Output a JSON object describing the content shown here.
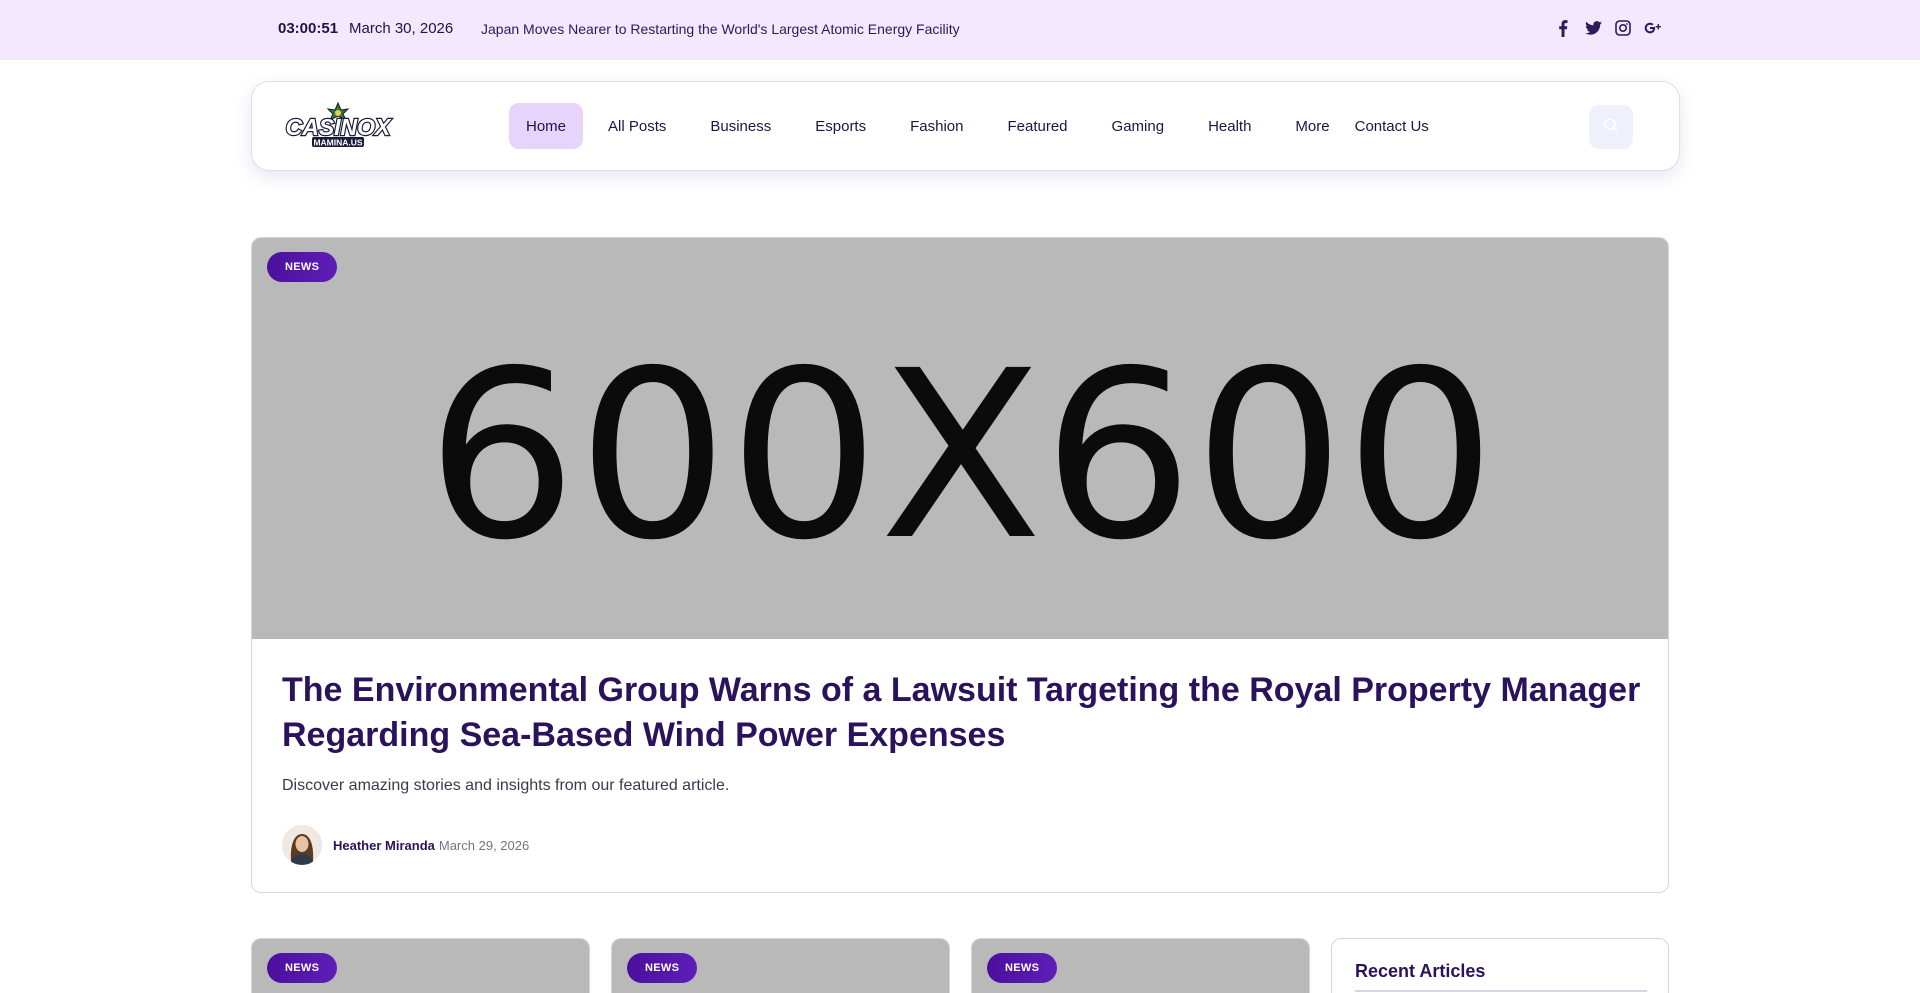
{
  "topbar": {
    "time": "03:00:51",
    "date": "March 30, 2026",
    "ticker": "Japan Moves Nearer to Restarting the World's Largest Atomic Energy Facility",
    "social": [
      "facebook-icon",
      "twitter-icon",
      "instagram-icon",
      "google-plus-icon"
    ]
  },
  "header": {
    "logo_text": "CASINOX",
    "logo_sub": "MAMINA.US",
    "nav": [
      "Home",
      "All Posts",
      "Business",
      "Esports",
      "Fashion",
      "Featured",
      "Gaming",
      "Health",
      "More",
      "Contact Us"
    ],
    "active_nav": "Home"
  },
  "featured": {
    "badge": "NEWS",
    "image_text": "600X600",
    "title": "The Environmental Group Warns of a Lawsuit Targeting the Royal Property Manager Regarding Sea-Based Wind Power Expenses",
    "excerpt": "Discover amazing stories and insights from our featured article.",
    "author": "Heather Miranda",
    "date": "March 29, 2026"
  },
  "cards": [
    {
      "badge": "NEWS"
    },
    {
      "badge": "NEWS"
    },
    {
      "badge": "NEWS"
    }
  ],
  "sidebar": {
    "recent_title": "Recent Articles"
  },
  "colors": {
    "topbar_bg": "#f3e8fd",
    "accent": "#4b0f9c",
    "title": "#2a125c",
    "active_nav_bg": "#e6d4fb"
  }
}
